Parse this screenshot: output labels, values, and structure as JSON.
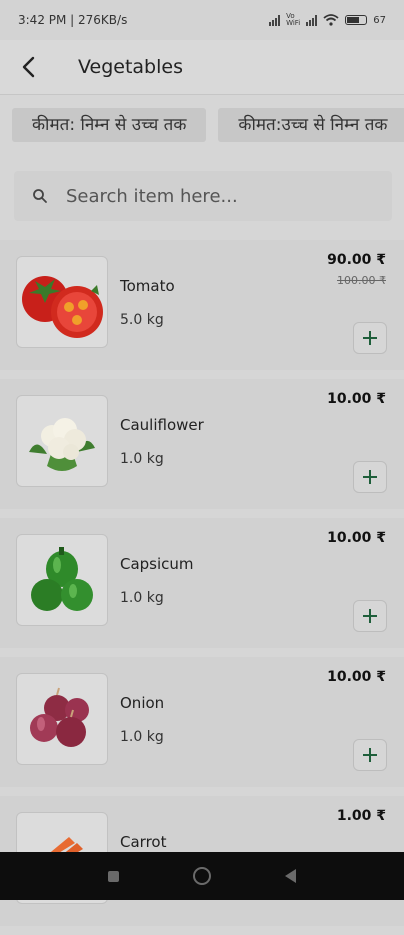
{
  "status": {
    "time_speed": "3:42 PM | 276KB/s",
    "battery": "67"
  },
  "header": {
    "title": "Vegetables"
  },
  "filters": [
    "कीमत: निम्न से उच्च तक",
    "कीमत:उच्च से निम्न तक"
  ],
  "search": {
    "placeholder": "Search item here..."
  },
  "items": [
    {
      "name": "Tomato",
      "qty": "5.0 kg",
      "price": "90.00 ₹",
      "old_price": "100.00 ₹",
      "image": "tomato"
    },
    {
      "name": "Cauliflower",
      "qty": "1.0 kg",
      "price": "10.00 ₹",
      "image": "cauliflower"
    },
    {
      "name": "Capsicum",
      "qty": "1.0 kg",
      "price": "10.00 ₹",
      "image": "capsicum"
    },
    {
      "name": "Onion",
      "qty": "1.0 kg",
      "price": "10.00 ₹",
      "image": "onion"
    },
    {
      "name": "Carrot",
      "qty": "",
      "price": "1.00 ₹",
      "image": "carrot"
    }
  ],
  "icons": {
    "back": "back-arrow-icon",
    "search": "search-icon",
    "add": "plus-icon"
  },
  "colors": {
    "add_icon": "#1e5e3a",
    "overlay_bg": "#d6d6d6"
  }
}
